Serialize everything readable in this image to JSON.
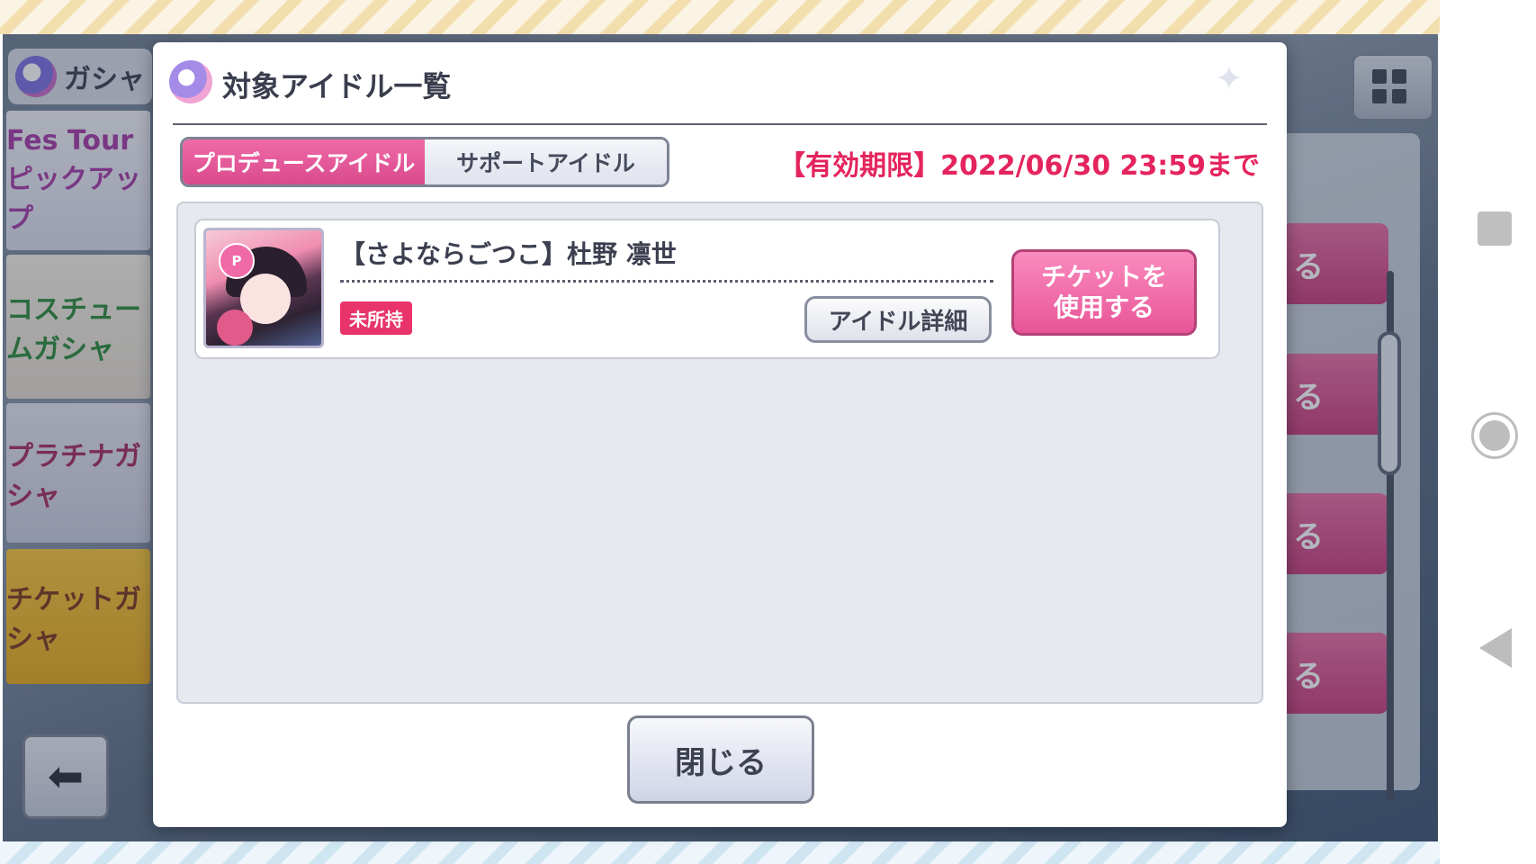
{
  "background": {
    "gacha_label": "ガシャ",
    "banners": [
      {
        "label": "Fes Tour ピックアップ"
      },
      {
        "label": "コスチュームガシャ"
      },
      {
        "label": "プラチナガシャ"
      },
      {
        "label": "チケットガシャ"
      }
    ],
    "right_buttons": [
      "る",
      "る",
      "る",
      "る"
    ]
  },
  "modal": {
    "title": "対象アイドル一覧",
    "tabs": [
      {
        "label": "プロデュースアイドル",
        "active": true
      },
      {
        "label": "サポートアイドル",
        "active": false
      }
    ],
    "expiry": "【有効期限】2022/06/30 23:59まで",
    "items": [
      {
        "name": "【さよならごつこ】杜野 凛世",
        "type_badge": "P",
        "status": "未所持",
        "detail_label": "アイドル詳細",
        "use_ticket_line1": "チケットを",
        "use_ticket_line2": "使用する"
      }
    ],
    "close_label": "閉じる"
  },
  "colors": {
    "accent_pink": "#e85597",
    "expiry_red": "#e4245d",
    "text_dark": "#3a3d4d"
  }
}
